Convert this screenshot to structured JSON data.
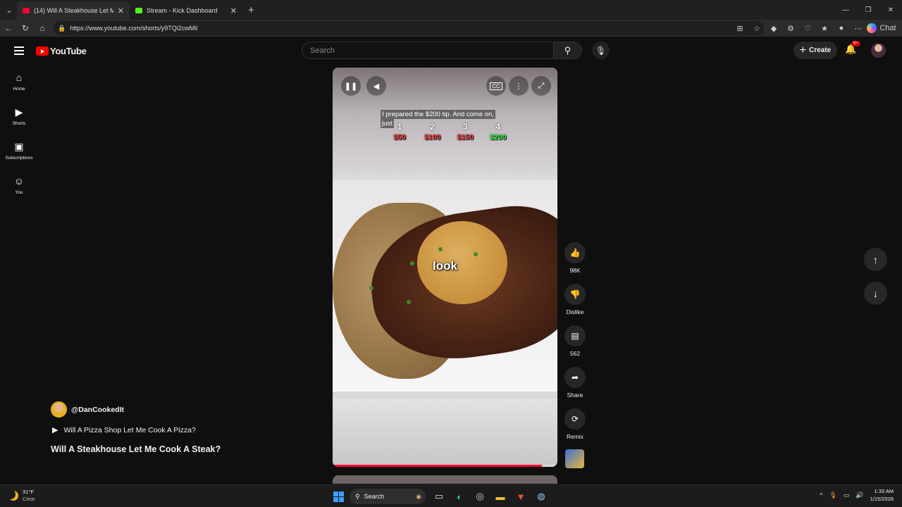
{
  "browser": {
    "tabs": [
      {
        "label": "(14) Will A Steakhouse Let Me",
        "active": true,
        "favicon_color": "#ff0033"
      },
      {
        "label": "Stream - Kick Dashboard",
        "active": false,
        "favicon_color": "#53fc18"
      }
    ],
    "url": "https://www.youtube.com/shorts/y9TQi2cwMil",
    "chat_label": "Chat"
  },
  "youtube": {
    "logo_text": "YouTube",
    "search_placeholder": "Search",
    "create_label": "Create",
    "notif_badge": "9+",
    "sidebar": [
      {
        "label": "Home",
        "icon": "home-icon"
      },
      {
        "label": "Shorts",
        "icon": "shorts-icon"
      },
      {
        "label": "Subscriptions",
        "icon": "subscriptions-icon"
      },
      {
        "label": "You",
        "icon": "you-icon"
      }
    ]
  },
  "video": {
    "caption_line1": "I prepared the $200 tip. And come on,",
    "caption_line2": "just",
    "tips": [
      {
        "num": "1",
        "amount": "$50",
        "color": "#ff3b3b"
      },
      {
        "num": "2",
        "amount": "$100",
        "color": "#ff3b3b"
      },
      {
        "num": "3",
        "amount": "$150",
        "color": "#ff3b3b"
      },
      {
        "num": "4",
        "amount": "$200",
        "color": "#3dff4a"
      }
    ],
    "overlay_word": "look",
    "progress_fraction": 0.93
  },
  "actions": {
    "likes": "98K",
    "dislike_label": "Dislike",
    "comments": "562",
    "share_label": "Share",
    "remix_label": "Remix"
  },
  "channel": {
    "handle": "@DanCookedIt",
    "related_title": "Will A Pizza Shop Let Me Cook A Pizza?",
    "video_title": "Will A Steakhouse Let Me Cook A Steak?"
  },
  "taskbar": {
    "temp": "31°F",
    "condition": "Clear",
    "search_label": "Search",
    "time": "1:33 AM",
    "date": "1/15/2026"
  }
}
